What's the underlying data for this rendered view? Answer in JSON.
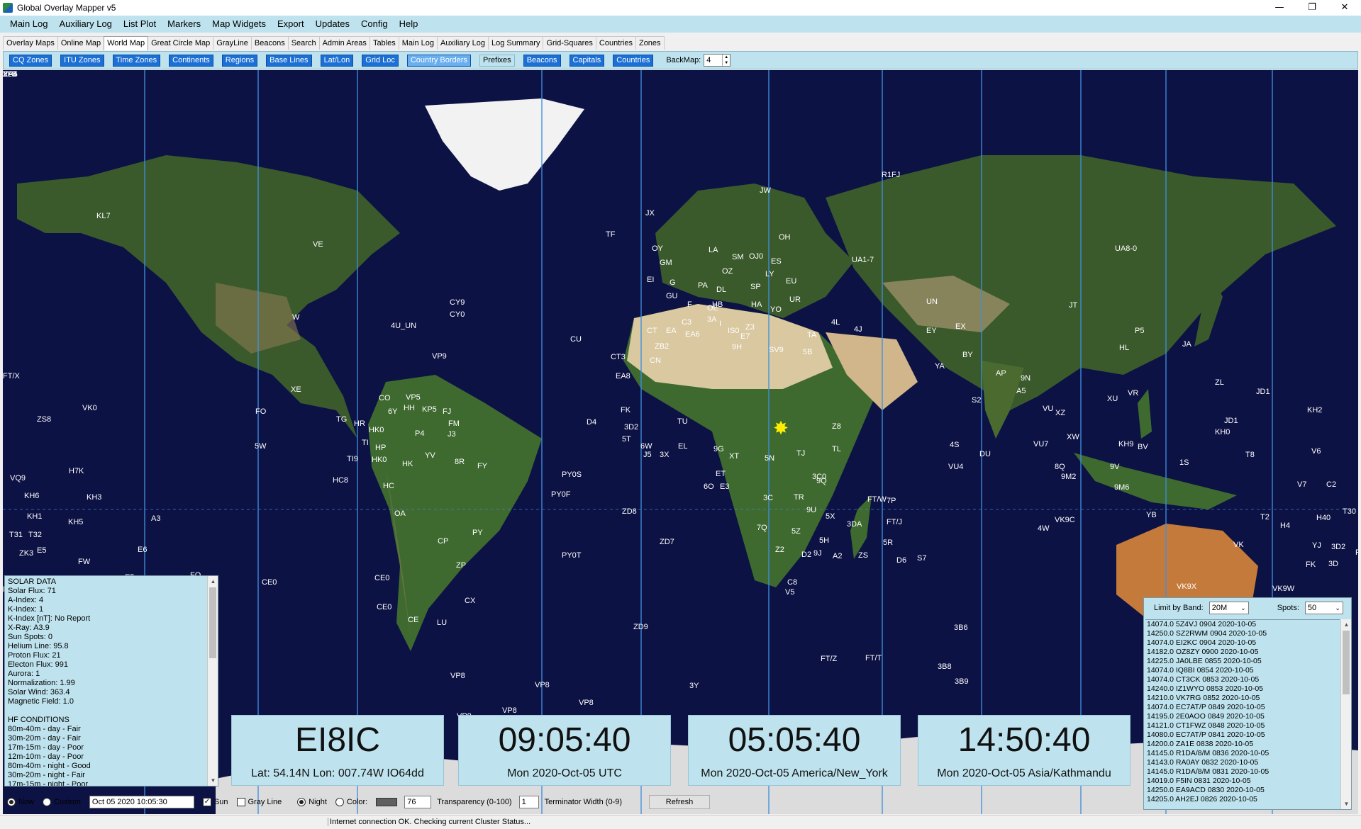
{
  "window": {
    "title": "Global Overlay Mapper v5",
    "minimize": "—",
    "restore": "❐",
    "close": "✕"
  },
  "menu": [
    "Main Log",
    "Auxiliary Log",
    "List Plot",
    "Markers",
    "Map Widgets",
    "Export",
    "Updates",
    "Config",
    "Help"
  ],
  "tabs": [
    "Overlay Maps",
    "Online Map",
    "World Map",
    "Great Circle Map",
    "GrayLine",
    "Beacons",
    "Search",
    "Admin Areas",
    "Tables",
    "Main Log",
    "Auxiliary Log",
    "Log Summary",
    "Grid-Squares",
    "Countries",
    "Zones"
  ],
  "active_tab": "World Map",
  "layers": {
    "cq": "CQ Zones",
    "itu": "ITU Zones",
    "tz": "Time Zones",
    "continents": "Continents",
    "regions": "Regions",
    "baselines": "Base Lines",
    "latlon": "Lat/Lon",
    "gridloc": "Grid Loc",
    "borders": "Country Borders",
    "prefixes": "Prefixes",
    "beacons": "Beacons",
    "capitals": "Capitals",
    "countries": "Countries",
    "backmap_label": "BackMap:",
    "backmap_value": "4"
  },
  "map_labels": [
    {
      "t": "KL7"
    },
    {
      "t": "VE"
    },
    {
      "t": "W"
    },
    {
      "t": "XE"
    },
    {
      "t": "CY9"
    },
    {
      "t": "CY0"
    },
    {
      "t": "4U_UN"
    },
    {
      "t": "VP9"
    },
    {
      "t": "CO"
    },
    {
      "t": "VP5"
    },
    {
      "t": "HH"
    },
    {
      "t": "KP5"
    },
    {
      "t": "FJ"
    },
    {
      "t": "FM"
    },
    {
      "t": "J3"
    },
    {
      "t": "6Y"
    },
    {
      "t": "TG"
    },
    {
      "t": "HR"
    },
    {
      "t": "HK0"
    },
    {
      "t": "TI"
    },
    {
      "t": "HP"
    },
    {
      "t": "P4"
    },
    {
      "t": "YV"
    },
    {
      "t": "HK"
    },
    {
      "t": "TI9"
    },
    {
      "t": "HK0"
    },
    {
      "t": "8R"
    },
    {
      "t": "FY"
    },
    {
      "t": "HC8"
    },
    {
      "t": "HC"
    },
    {
      "t": "OA"
    },
    {
      "t": "PY"
    },
    {
      "t": "CP"
    },
    {
      "t": "ZP"
    },
    {
      "t": "CX"
    },
    {
      "t": "CE"
    },
    {
      "t": "LU"
    },
    {
      "t": "CE0"
    },
    {
      "t": "CE0"
    },
    {
      "t": "CE0"
    },
    {
      "t": "VP8"
    },
    {
      "t": "VP8"
    },
    {
      "t": "VP8"
    },
    {
      "t": "VP8"
    },
    {
      "t": "VP8"
    },
    {
      "t": "3Y"
    },
    {
      "t": "3Y"
    },
    {
      "t": "PY0S"
    },
    {
      "t": "PY0F"
    },
    {
      "t": "PY0T"
    },
    {
      "t": "ZD8"
    },
    {
      "t": "ZD7"
    },
    {
      "t": "ZD9"
    },
    {
      "t": "D4"
    },
    {
      "t": "CU"
    },
    {
      "t": "CT3"
    },
    {
      "t": "EA8"
    },
    {
      "t": "TF"
    },
    {
      "t": "JX"
    },
    {
      "t": "OY"
    },
    {
      "t": "GM"
    },
    {
      "t": "EI"
    },
    {
      "t": "G"
    },
    {
      "t": "GU"
    },
    {
      "t": "F"
    },
    {
      "t": "CT"
    },
    {
      "t": "EA"
    },
    {
      "t": "EA6"
    },
    {
      "t": "C3"
    },
    {
      "t": "ZB2"
    },
    {
      "t": "CN"
    },
    {
      "t": "PA"
    },
    {
      "t": "DL"
    },
    {
      "t": "OZ"
    },
    {
      "t": "SM"
    },
    {
      "t": "OH"
    },
    {
      "t": "OJ0"
    },
    {
      "t": "LA"
    },
    {
      "t": "ES"
    },
    {
      "t": "LY"
    },
    {
      "t": "EU"
    },
    {
      "t": "SP"
    },
    {
      "t": "OE"
    },
    {
      "t": "HB"
    },
    {
      "t": "HA"
    },
    {
      "t": "YO"
    },
    {
      "t": "UR"
    },
    {
      "t": "3A"
    },
    {
      "t": "I"
    },
    {
      "t": "IS0"
    },
    {
      "t": "E7"
    },
    {
      "t": "Z3"
    },
    {
      "t": "TA"
    },
    {
      "t": "9H"
    },
    {
      "t": "SV9"
    },
    {
      "t": "5B"
    },
    {
      "t": "4L"
    },
    {
      "t": "4J"
    },
    {
      "t": "UA1-7"
    },
    {
      "t": "UA8-0"
    },
    {
      "t": "R1FJ"
    },
    {
      "t": "JW"
    },
    {
      "t": "UN"
    },
    {
      "t": "JT"
    },
    {
      "t": "EX"
    },
    {
      "t": "EY"
    },
    {
      "t": "P5"
    },
    {
      "t": "HL"
    },
    {
      "t": "JA"
    },
    {
      "t": "BY"
    },
    {
      "t": "YA"
    },
    {
      "t": "AP"
    },
    {
      "t": "9N"
    },
    {
      "t": "A5"
    },
    {
      "t": "S2"
    },
    {
      "t": "VU"
    },
    {
      "t": "XZ"
    },
    {
      "t": "XW"
    },
    {
      "t": "XU"
    },
    {
      "t": "VR"
    },
    {
      "t": "BV"
    },
    {
      "t": "DU"
    },
    {
      "t": "4S"
    },
    {
      "t": "VU7"
    },
    {
      "t": "VU4"
    },
    {
      "t": "8Q"
    },
    {
      "t": "9M2"
    },
    {
      "t": "9V"
    },
    {
      "t": "9M6"
    },
    {
      "t": "YB"
    },
    {
      "t": "4W"
    },
    {
      "t": "VK9C"
    },
    {
      "t": "VK9X"
    },
    {
      "t": "VK"
    },
    {
      "t": "VK9W"
    },
    {
      "t": "VK9L"
    },
    {
      "t": "VK9N"
    },
    {
      "t": "ZL"
    },
    {
      "t": "JD1"
    },
    {
      "t": "JD1"
    },
    {
      "t": "KH0"
    },
    {
      "t": "KH2"
    },
    {
      "t": "KH9"
    },
    {
      "t": "1S"
    },
    {
      "t": "T8"
    },
    {
      "t": "V6"
    },
    {
      "t": "V7"
    },
    {
      "t": "C2"
    },
    {
      "t": "T30"
    },
    {
      "t": "T2"
    },
    {
      "t": "H4"
    },
    {
      "t": "H40"
    },
    {
      "t": "3D2"
    },
    {
      "t": "YJ"
    },
    {
      "t": "3D"
    },
    {
      "t": "P2"
    },
    {
      "t": "FK"
    },
    {
      "t": "FK"
    },
    {
      "t": "3D2"
    },
    {
      "t": "5T"
    },
    {
      "t": "6W"
    },
    {
      "t": "J5"
    },
    {
      "t": "3X"
    },
    {
      "t": "EL"
    },
    {
      "t": "TU"
    },
    {
      "t": "9G"
    },
    {
      "t": "XT"
    },
    {
      "t": "5N"
    },
    {
      "t": "TJ"
    },
    {
      "t": "TL"
    },
    {
      "t": "Z8"
    },
    {
      "t": "ET"
    },
    {
      "t": "E3"
    },
    {
      "t": "6O"
    },
    {
      "t": "3C"
    },
    {
      "t": "TR"
    },
    {
      "t": "3C0"
    },
    {
      "t": "9Q"
    },
    {
      "t": "9U"
    },
    {
      "t": "5X"
    },
    {
      "t": "5Z"
    },
    {
      "t": "5H"
    },
    {
      "t": "D2"
    },
    {
      "t": "9J"
    },
    {
      "t": "7Q"
    },
    {
      "t": "Z2"
    },
    {
      "t": "C8"
    },
    {
      "t": "V5"
    },
    {
      "t": "A2"
    },
    {
      "t": "ZS"
    },
    {
      "t": "3DA"
    },
    {
      "t": "7P"
    },
    {
      "t": "FT/J"
    },
    {
      "t": "5R"
    },
    {
      "t": "D6"
    },
    {
      "t": "S7"
    },
    {
      "t": "3B6"
    },
    {
      "t": "FT/T"
    },
    {
      "t": "3B8"
    },
    {
      "t": "3B9"
    },
    {
      "t": "FT/Z"
    },
    {
      "t": "FT/W"
    },
    {
      "t": "FT/X"
    },
    {
      "t": "VK0"
    },
    {
      "t": "ZS8"
    },
    {
      "t": "VQ9"
    },
    {
      "t": "H7K"
    },
    {
      "t": "KH6"
    },
    {
      "t": "KH3"
    },
    {
      "t": "KH1"
    },
    {
      "t": "KH5"
    },
    {
      "t": "T31"
    },
    {
      "t": "T32"
    },
    {
      "t": "ZK3"
    },
    {
      "t": "E5"
    },
    {
      "t": "FW"
    },
    {
      "t": "5W"
    },
    {
      "t": "A3"
    },
    {
      "t": "E6"
    },
    {
      "t": "E5"
    },
    {
      "t": "FO"
    },
    {
      "t": "FO"
    },
    {
      "t": "FO"
    },
    {
      "t": "FO"
    },
    {
      "t": "ZL8"
    },
    {
      "t": "XA4"
    },
    {
      "t": "VP6"
    },
    {
      "t": "ZL7"
    }
  ],
  "solar": {
    "lines": [
      "SOLAR DATA",
      "Solar Flux:  71",
      "A-Index:  4",
      "K-Index:  1",
      "K-Index [nT]: No Report",
      "X-Ray:  A3.9",
      "Sun Spots: 0",
      "Helium Line:  95.8",
      "Proton Flux:  21",
      "Electon Flux:  991",
      "Aurora:  1",
      "Normalization:  1.99",
      "Solar Wind:  363.4",
      "Magnetic Field:   1.0",
      "",
      "HF CONDITIONS",
      "80m-40m - day - Fair",
      "30m-20m - day - Fair",
      "17m-15m - day - Poor",
      "12m-10m - day - Poor",
      "80m-40m - night - Good",
      "30m-20m - night - Fair",
      "17m-15m - night - Poor"
    ]
  },
  "clocks": [
    {
      "big": "EI8IC",
      "small": "Lat: 54.14N  Lon: 007.74W  IO64dd"
    },
    {
      "big": "09:05:40",
      "small": "Mon 2020-Oct-05  UTC"
    },
    {
      "big": "05:05:40",
      "small": "Mon 2020-Oct-05  America/New_York"
    },
    {
      "big": "14:50:40",
      "small": "Mon 2020-Oct-05  Asia/Kathmandu"
    }
  ],
  "spots_panel": {
    "band_label": "Limit by Band:",
    "band_value": "20M",
    "spots_label": "Spots:",
    "spots_value": "50",
    "items": [
      "14074.0 5Z4VJ 0904 2020-10-05",
      "14250.0 SZ2RWM 0904 2020-10-05",
      "14074.0 EI2KC 0904 2020-10-05",
      "14182.0 OZ8ZY 0900 2020-10-05",
      "14225.0 JA0LBE 0855 2020-10-05",
      "14074.0 IQ8BI 0854 2020-10-05",
      "14074.0 CT3CK 0853 2020-10-05",
      "14240.0 IZ1WYO 0853 2020-10-05",
      "14210.0 VK7RG 0852 2020-10-05",
      "14074.0 EC7AT/P 0849 2020-10-05",
      "14195.0 2E0AOO 0849 2020-10-05",
      "14121.0 CT1FWZ 0848 2020-10-05",
      "14080.0 EC7AT/P 0841 2020-10-05",
      "14200.0 ZA1E 0838 2020-10-05",
      "14145.0 R1DA/8/M 0836 2020-10-05",
      "14143.0 RA0AY 0832 2020-10-05",
      "14145.0 R1DA/8/M 0831 2020-10-05",
      "14019.0 F5IN 0831 2020-10-05",
      "14250.0 EA9ACD 0830 2020-10-05",
      "14205.0 AH2EJ 0826 2020-10-05"
    ]
  },
  "controls": {
    "now": "Now",
    "custom": "Custom",
    "datetime": "Oct 05 2020    10:05:30",
    "sun": "Sun",
    "grayline": "Gray Line",
    "night": "Night",
    "color": "Color:",
    "transparency_value": "76",
    "transparency_label": "Transparency (0-100)",
    "terminator_value": "1",
    "terminator_label": "Terminator Width (0-9)",
    "refresh": "Refresh"
  },
  "status": "Internet connection OK. Checking current Cluster Status...",
  "colors": {
    "ocean": "#0d1244",
    "panel": "#bfe3ee",
    "zone_line": "#3f8fe0",
    "land": "#2e4a22"
  }
}
